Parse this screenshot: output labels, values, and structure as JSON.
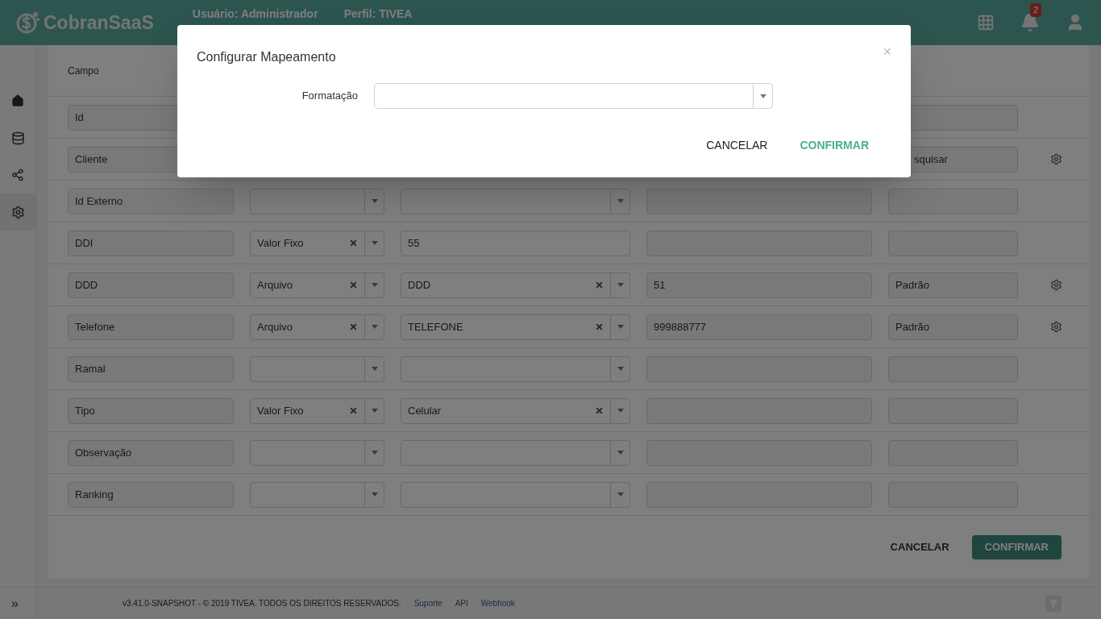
{
  "header": {
    "logo": "CobranSaaS",
    "user_label": "Usuário:",
    "user": "Administrador",
    "profile_label": "Perfil:",
    "profile": "TIVEA",
    "notifications": "2"
  },
  "table": {
    "heading": "Campo",
    "rows": [
      {
        "campo": "Id",
        "gear": false
      },
      {
        "campo": "Cliente",
        "col5": "squisar",
        "cut_left": true,
        "gear": true
      },
      {
        "campo": "Id Externo",
        "source": {},
        "col3": {
          "kind": "select"
        },
        "gear": false
      },
      {
        "campo": "DDI",
        "source": {
          "value": "Valor Fixo"
        },
        "col3": {
          "kind": "input",
          "value": "55"
        },
        "gear": false
      },
      {
        "campo": "DDD",
        "source": {
          "value": "Arquivo"
        },
        "col3": {
          "kind": "select",
          "value": "DDD"
        },
        "col4": "51",
        "col5": "Padrão",
        "gear": true
      },
      {
        "campo": "Telefone",
        "source": {
          "value": "Arquivo"
        },
        "col3": {
          "kind": "select",
          "value": "TELEFONE"
        },
        "col4": "999888777",
        "col5": "Padrão",
        "gear": true
      },
      {
        "campo": "Ramal",
        "source": {},
        "col3": {
          "kind": "select"
        },
        "gear": false
      },
      {
        "campo": "Tipo",
        "source": {
          "value": "Valor Fixo"
        },
        "col3": {
          "kind": "select",
          "value": "Celular"
        },
        "gear": false
      },
      {
        "campo": "Observação",
        "source": {},
        "col3": {
          "kind": "select"
        },
        "gear": false
      },
      {
        "campo": "Ranking",
        "source": {},
        "col3": {
          "kind": "select"
        },
        "gear": false
      }
    ]
  },
  "actions": {
    "cancel": "CANCELAR",
    "confirm": "CONFIRMAR"
  },
  "footer": {
    "expand": "»",
    "copyright": "v3.41.0-SNAPSHOT - © 2019 TIVEA. TODOS OS DIREITOS RESERVADOS.",
    "links": [
      "Suporte",
      "API",
      "Webhook"
    ]
  },
  "dialog": {
    "title": "Configurar Mapeamento",
    "close": "×",
    "field_label": "Formatação",
    "cancel": "CANCELAR",
    "confirm": "CONFIRMAR"
  }
}
